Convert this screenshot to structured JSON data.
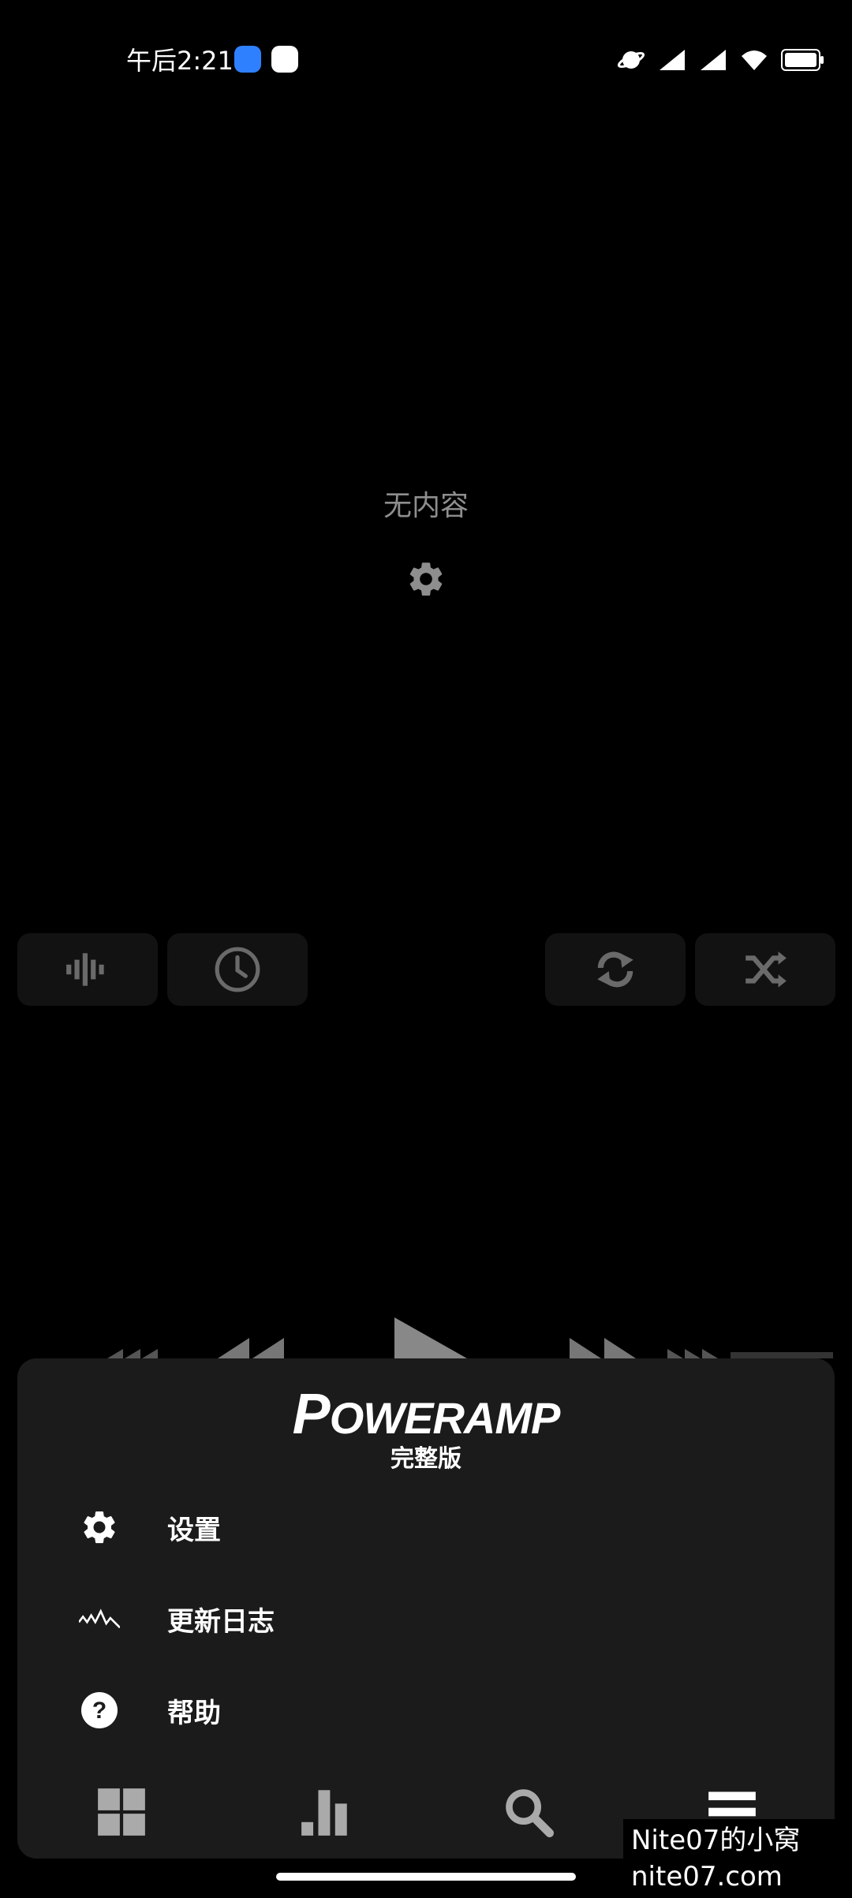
{
  "status_bar": {
    "time": "午后2:21",
    "icons_left": [
      "notification-app-icon",
      "cat-app-icon"
    ],
    "icons_right": [
      "planet-icon",
      "signal-icon",
      "signal-icon",
      "wifi-icon",
      "battery-icon"
    ]
  },
  "empty_state": {
    "message": "无内容",
    "icon": "gear-icon"
  },
  "controls": {
    "left": [
      "equalizer-icon",
      "clock-icon"
    ],
    "right": [
      "repeat-icon",
      "shuffle-icon"
    ]
  },
  "menu": {
    "logo_first": "P",
    "logo_rest": "OWERAMP",
    "edition": "完整版",
    "items": [
      {
        "label": "设置",
        "icon": "gear-icon"
      },
      {
        "label": "更新日志",
        "icon": "waveform-icon"
      },
      {
        "label": "帮助",
        "icon": "help-icon"
      }
    ]
  },
  "bottom_nav": [
    "grid-icon",
    "bar-chart-icon",
    "search-icon",
    "menu-icon"
  ],
  "watermark": {
    "line1": "Nite07的小窝",
    "line2": "nite07.com"
  },
  "colors": {
    "background": "#000000",
    "sheet": "#1b1b1b",
    "muted_text": "#8e8e8e",
    "icon_dim": "#6a6a6a",
    "icon_light": "#aaaaaa"
  }
}
